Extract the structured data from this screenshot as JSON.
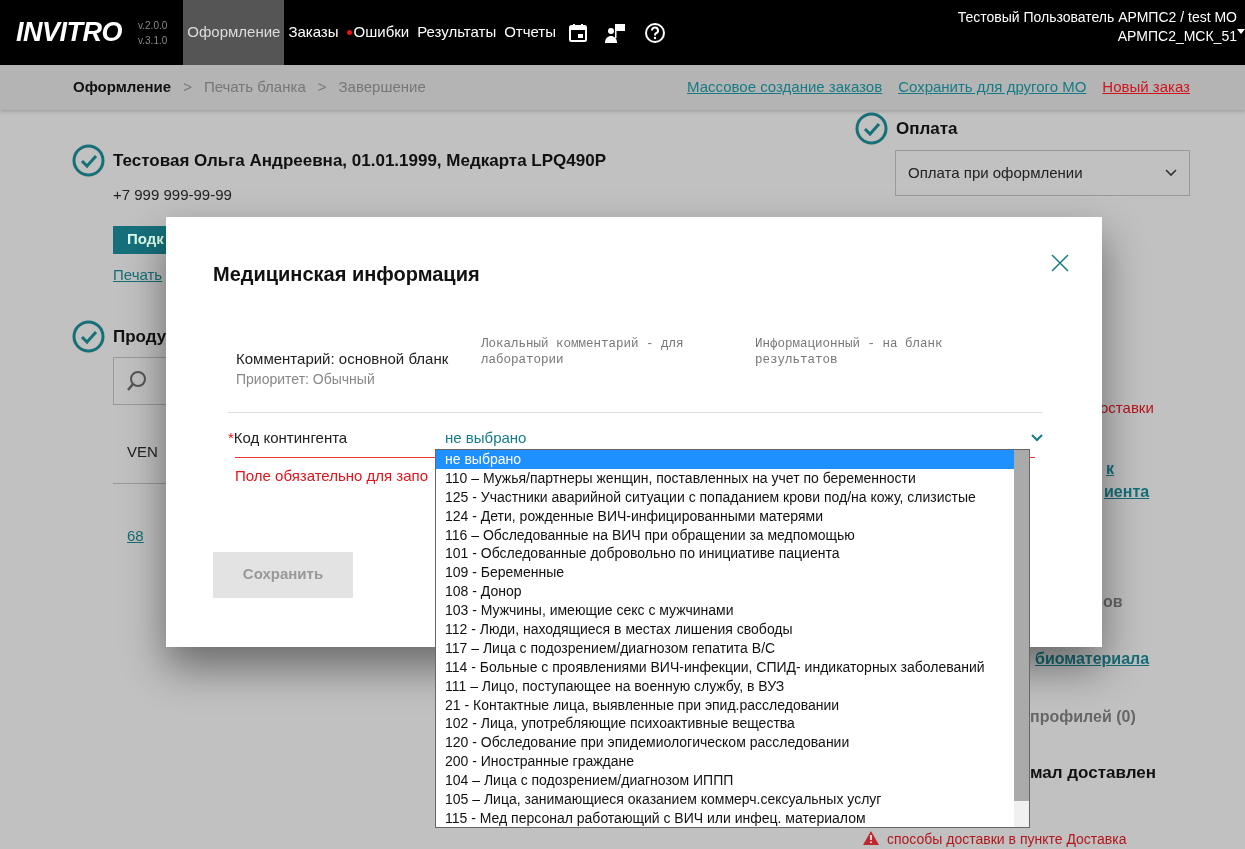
{
  "navbar": {
    "logo": "INVITRO",
    "versions": [
      "v.2.0.0",
      "v.3.1.0"
    ],
    "menu": [
      {
        "label": "Оформление",
        "selected": true,
        "alert": false
      },
      {
        "label": "Заказы",
        "selected": false,
        "alert": false
      },
      {
        "label": "Ошибки",
        "selected": false,
        "alert": true
      },
      {
        "label": "Результаты",
        "selected": false,
        "alert": false
      },
      {
        "label": "Отчеты",
        "selected": false,
        "alert": false
      }
    ],
    "user": [
      "Тестовый Пользователь АРМПС2 / test МО",
      "АРМПС2_МСК_51"
    ]
  },
  "steps": [
    {
      "label": "Оформление",
      "selected": true
    },
    {
      "separator": ">",
      "label": "Печать бланка",
      "selected": false
    },
    {
      "separator": ">",
      "label": "Завершение",
      "selected": false
    }
  ],
  "actions": [
    {
      "label": "Массовое создание заказов",
      "kind": "link"
    },
    {
      "label": "Сохранить для другого МО",
      "kind": "link"
    },
    {
      "label": "Новый заказ",
      "kind": "danger"
    }
  ],
  "patient": {
    "title": "Тестовая Ольга Андреевна, 01.01.1999, Медкарта LPQ490P",
    "phone": "+7 999 999-99-99",
    "button": "Подк",
    "link": "Печать"
  },
  "products": {
    "title": "Проду",
    "column": "VEN",
    "link": "68"
  },
  "payment": {
    "title": "Оплата",
    "value": "Оплата при оформлении"
  },
  "right_fragments": [
    {
      "text": "оставки",
      "kind": "error"
    },
    {
      "text": "к",
      "kind": "link"
    },
    {
      "text": "иента",
      "kind": "link"
    },
    {
      "text": "ов",
      "kind": "muted"
    },
    {
      "text": "биоматериала",
      "kind": "link"
    },
    {
      "text": "профилей (0)",
      "kind": "muted"
    },
    {
      "text": "мал доставлен",
      "kind": "heading"
    }
  ],
  "warning": "способы доставки в пункте Доставка",
  "modal": {
    "title": "Медицинская информация",
    "comment": {
      "label": "Комментарий: основной бланк",
      "priority": "Приоритет: Обычный"
    },
    "notes": [
      "Локальный комментарий - для лаборатории",
      "Информационный - на бланк результатов"
    ],
    "field": {
      "label": "Код контингента",
      "required_mark": "*",
      "value": "не выбрано",
      "error": "Поле обязательно для запо"
    },
    "save": {
      "label": "Сохранить",
      "disabled": true
    },
    "options": [
      {
        "label": "не выбрано",
        "selected": true
      },
      {
        "label": "110 – Мужья/партнеры женщин, поставленных на учет по беременности",
        "selected": false
      },
      {
        "label": "125 - Участники аварийной ситуации с попаданием крови под/на кожу, слизистые",
        "selected": false
      },
      {
        "label": "124 - Дети, рожденные ВИЧ-инфицированными матерями",
        "selected": false
      },
      {
        "label": "116 – Обследованные на ВИЧ при обращении за медпомощью",
        "selected": false
      },
      {
        "label": "101 - Обследованные добровольно по инициативе пациента",
        "selected": false
      },
      {
        "label": "109 - Беременные",
        "selected": false
      },
      {
        "label": "108 - Донор",
        "selected": false
      },
      {
        "label": "103 - Мужчины, имеющие секс с мужчинами",
        "selected": false
      },
      {
        "label": "112 - Люди, находящиеся в местах лишения свободы",
        "selected": false
      },
      {
        "label": "117 – Лица с подозрением/диагнозом гепатита В/С",
        "selected": false
      },
      {
        "label": "114 - Больные с проявлениями ВИЧ-инфекции, СПИД- индикаторных заболеваний",
        "selected": false
      },
      {
        "label": "111 – Лицо, поступающее на военную службу, в ВУЗ",
        "selected": false
      },
      {
        "label": "21 - Контактные лица, выявленные при эпид.расследовании",
        "selected": false
      },
      {
        "label": "102 - Лица, употребляющие психоактивные вещества",
        "selected": false
      },
      {
        "label": "120 - Обследование при эпидемиологическом расследовании",
        "selected": false
      },
      {
        "label": "200 - Иностранные граждане",
        "selected": false
      },
      {
        "label": "104 – Лица с подозрением/диагнозом ИППП",
        "selected": false
      },
      {
        "label": "105 – Лица, занимающиеся оказанием коммерч.сексуальных услуг",
        "selected": false
      },
      {
        "label": "115 - Мед персонал работающий с ВИЧ или инфец. материалом",
        "selected": false
      }
    ]
  }
}
